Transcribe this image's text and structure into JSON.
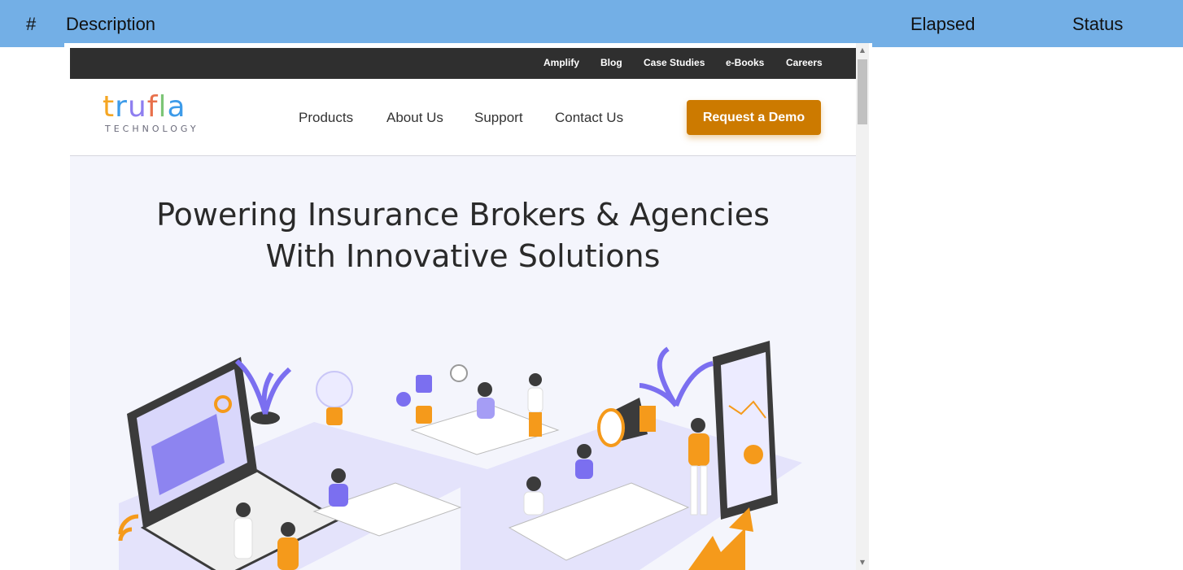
{
  "table_header": {
    "num": "#",
    "description": "Description",
    "elapsed": "Elapsed",
    "status": "Status"
  },
  "site": {
    "topbar_links": [
      "Amplify",
      "Blog",
      "Case Studies",
      "e-Books",
      "Careers"
    ],
    "logo": {
      "word": "trufla",
      "subtitle": "TECHNOLOGY"
    },
    "nav_items": [
      "Products",
      "About Us",
      "Support",
      "Contact Us"
    ],
    "cta_label": "Request a Demo",
    "hero_line1": "Powering Insurance Brokers & Agencies",
    "hero_line2": "With Innovative Solutions",
    "colors": {
      "accent": "#cc7a00",
      "header_bg": "#73afe6",
      "topbar_bg": "#2f2f2f",
      "illus_purple": "#7b6ff0",
      "illus_orange": "#f59a1b"
    }
  },
  "icons": {
    "scroll_up": "▲",
    "scroll_down": "▼"
  }
}
